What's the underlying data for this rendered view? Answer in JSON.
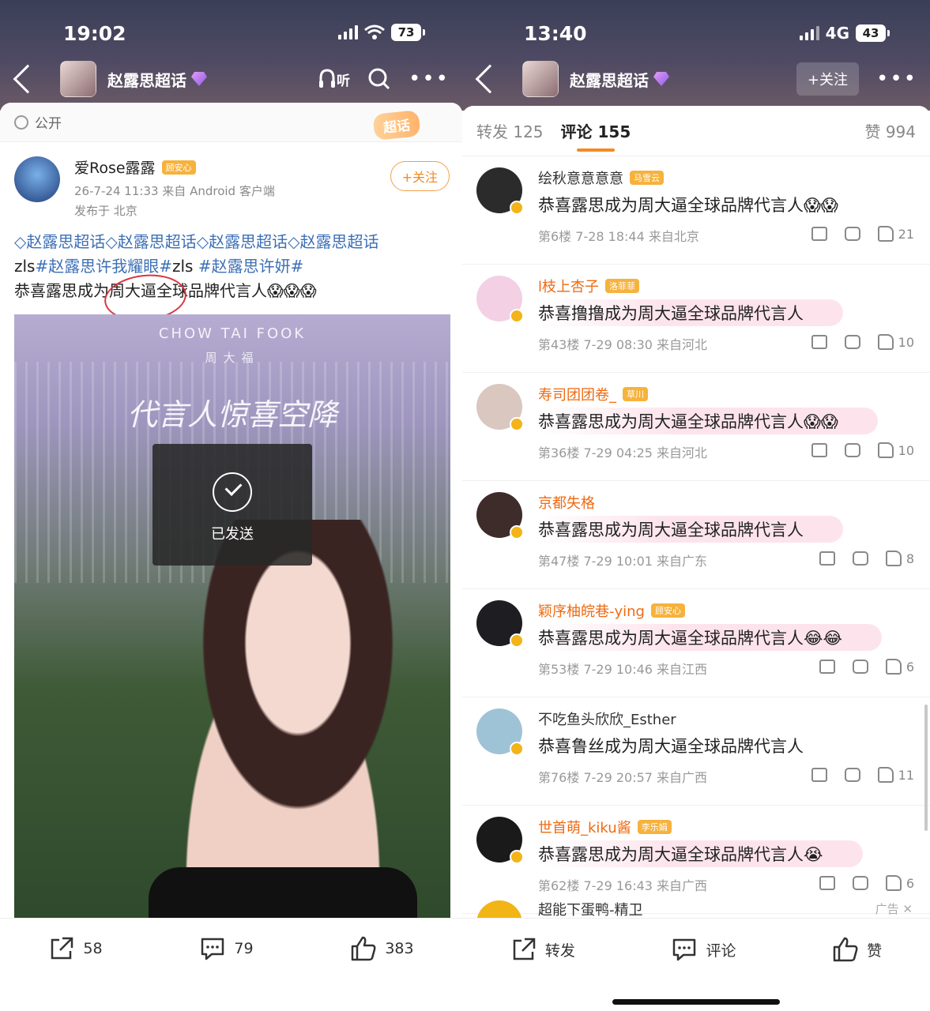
{
  "left": {
    "status": {
      "time": "19:02",
      "battery": "73"
    },
    "nav": {
      "title": "赵露思超话",
      "listen": "听"
    },
    "visibility": "公开",
    "chaohua_badge": "超话",
    "author": {
      "name": "爱Rose露露",
      "badge": "顾安心",
      "meta": "26-7-24 11:33  来自 Android 客户端",
      "location": "发布于 北京",
      "follow": "+关注"
    },
    "post": {
      "line1": "◇赵露思超话◇赵露思超话◇赵露思超话◇赵露思超话",
      "line2_a": "zls",
      "line2_tag1": "#赵露思许我耀眼#",
      "line2_b": "zls ",
      "line2_tag2": "#赵露思许妍#",
      "line3": "恭喜露思成为周大逼全球品牌代言人😱😱😱"
    },
    "image": {
      "brand": "CHOW TAI FOOK",
      "brand_cn": "周大福",
      "slogan": "代言人惊喜空降"
    },
    "toast": "已发送",
    "actions": {
      "share": "58",
      "comment": "79",
      "like": "383"
    }
  },
  "right": {
    "status": {
      "time": "13:40",
      "network": "4G",
      "battery": "43"
    },
    "nav": {
      "title": "赵露思超话",
      "follow": "+关注"
    },
    "tabs": {
      "reposts": "转发 125",
      "comments": "评论 155",
      "likes": "赞 994"
    },
    "comments": [
      {
        "name": "绘秋意意意意",
        "badge": "马雪云",
        "text": "恭喜露思成为周大逼全球品牌代言人😱😱",
        "meta": "第6楼 7-28 18:44 来自北京",
        "likes": "21",
        "name_color": "gray",
        "avatar": "#2b2b2b",
        "bubble": false
      },
      {
        "name": "l枝上杏子",
        "badge": "洛菲菲",
        "text": "恭喜撸撸成为周大逼全球品牌代言人",
        "meta": "第43楼 7-29 08:30 来自河北",
        "likes": "10",
        "name_color": "orange",
        "avatar": "#f3d0e4",
        "bubble": true
      },
      {
        "name": "寿司团团卷_",
        "badge": "草川",
        "text": "恭喜露思成为周大逼全球品牌代言人😱😱",
        "meta": "第36楼 7-29 04:25 来自河北",
        "likes": "10",
        "name_color": "orange",
        "avatar": "#d9c7c0",
        "bubble": true
      },
      {
        "name": "京都失格",
        "badge": "",
        "text": "恭喜露思成为周大逼全球品牌代言人",
        "meta": "第47楼 7-29 10:01 来自广东",
        "likes": "8",
        "name_color": "orange",
        "avatar": "#3d2c2a",
        "bubble": true
      },
      {
        "name": "颖序柚皖巷-ying",
        "badge": "顾安心",
        "text": "恭喜露思成为周大逼全球品牌代言人😂😂",
        "meta": "第53楼 7-29 10:46 来自江西",
        "likes": "6",
        "name_color": "orange",
        "avatar": "#1d1d22",
        "bubble": true
      },
      {
        "name": "不吃鱼头欣欣_Esther",
        "badge": "",
        "text": "恭喜鲁丝成为周大逼全球品牌代言人",
        "meta": "第76楼 7-29 20:57 来自广西",
        "likes": "11",
        "name_color": "gray",
        "avatar": "#9fc3d6",
        "bubble": false
      },
      {
        "name": "世首萌_kiku酱",
        "badge": "李乐娟",
        "text": "恭喜露思成为周大逼全球品牌代言人😭",
        "meta": "第62楼 7-29 16:43 来自广西",
        "likes": "6",
        "name_color": "orange",
        "avatar": "#1a1a1a",
        "bubble": true
      }
    ],
    "ad": {
      "name": "超能下蛋鸭-精卫",
      "label": "广告"
    },
    "actions": {
      "share": "转发",
      "comment": "评论",
      "like": "赞"
    }
  }
}
